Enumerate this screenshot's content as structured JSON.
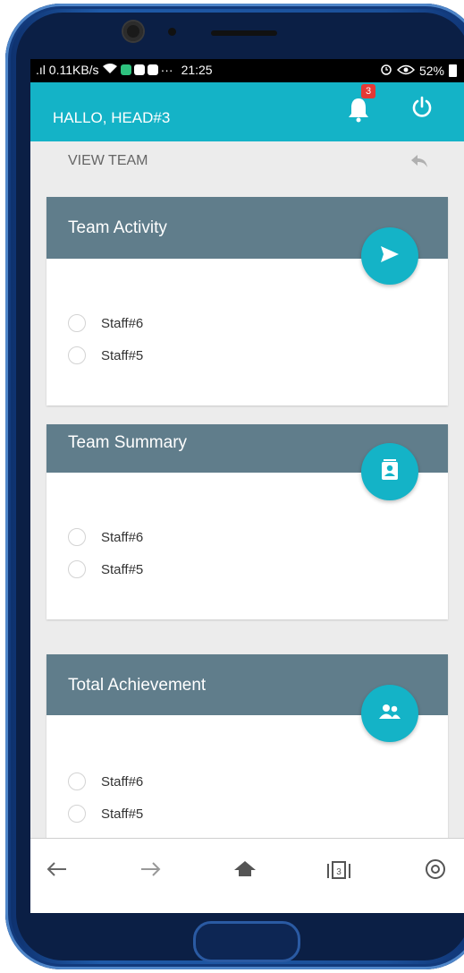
{
  "status_bar": {
    "network": ".ıl 0.11KB/s",
    "time": "21:25",
    "battery": "52%"
  },
  "app_bar": {
    "title": "HALLO, HEAD#3",
    "notification_count": "3",
    "icons": [
      "bell-icon",
      "power-icon"
    ]
  },
  "sub_header": {
    "title": "VIEW TEAM",
    "icons": [
      "reply-icon"
    ]
  },
  "cards": [
    {
      "title": "Team Activity",
      "fab_icon": "send-icon",
      "items": [
        {
          "label": "Staff#6"
        },
        {
          "label": "Staff#5"
        }
      ]
    },
    {
      "title": "Team Summary",
      "fab_icon": "contact-card-icon",
      "items": [
        {
          "label": "Staff#6"
        },
        {
          "label": "Staff#5"
        }
      ]
    },
    {
      "title": "Total Achievement",
      "fab_icon": "group-icon",
      "items": [
        {
          "label": "Staff#6"
        },
        {
          "label": "Staff#5"
        }
      ]
    }
  ],
  "nav_bar": {
    "icons": [
      "back-arrow-icon",
      "forward-arrow-icon",
      "home-icon",
      "tabs-icon",
      "settings-icon"
    ],
    "tab_count": "3"
  },
  "colors": {
    "accent": "#14b3c7",
    "card_header": "#607d8b",
    "background": "#ececec"
  }
}
